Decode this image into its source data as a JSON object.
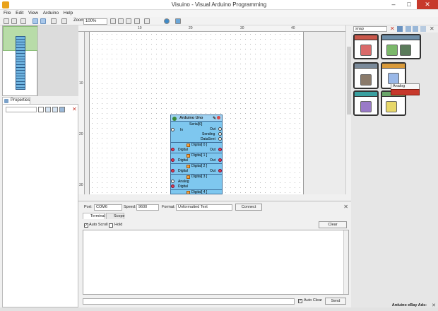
{
  "window": {
    "title": "Visuino - Visual Arduino Programming",
    "minimize": "–",
    "maximize": "□",
    "close": "✕"
  },
  "menu": [
    "File",
    "Edit",
    "View",
    "Arduino",
    "Help"
  ],
  "toolbar": {
    "zoom_label": "Zoom:",
    "zoom_value": "100%"
  },
  "properties": {
    "tab_label": "Properties"
  },
  "rulers": {
    "top": [
      "10",
      "20",
      "30",
      "40"
    ],
    "left": [
      "10",
      "20",
      "30"
    ]
  },
  "component": {
    "title": "Arduino Uno",
    "serial": "Serial[0]",
    "in_label": "In",
    "out_label": "Out",
    "sending_label": "Sending",
    "datasent_label": "DataSent",
    "digital_label": "Digital",
    "analog_label": "Analog",
    "channels": [
      "Digital[ 0 ]",
      "Digital[ 1 ]",
      "Digital[ 2 ]",
      "Digital[ 3 ]",
      "Digital[ 4 ]"
    ]
  },
  "palette": {
    "search_value": "snap",
    "tooltip": "Analog Snapshot"
  },
  "serial_panel": {
    "port_label": "Port:",
    "port_value": "COM6",
    "speed_label": "Speed:",
    "speed_value": "9600",
    "format_label": "Format:",
    "format_value": "Unformatted Text",
    "connect_label": "Connect",
    "tabs": [
      "Terminal",
      "Scope"
    ],
    "auto_scroll_label": "Auto Scroll",
    "auto_scroll_checked": true,
    "hold_label": "Hold",
    "hold_checked": false,
    "clear_label": "Clear",
    "auto_clear_label": "Auto Clear",
    "auto_clear_checked": true,
    "send_label": "Send"
  },
  "ads": {
    "label": "Arduino eBay Ads:"
  },
  "colors": {
    "accent": "#c7392c",
    "component_body": "#7ec7ef",
    "overview_view": "#b8dca8"
  }
}
